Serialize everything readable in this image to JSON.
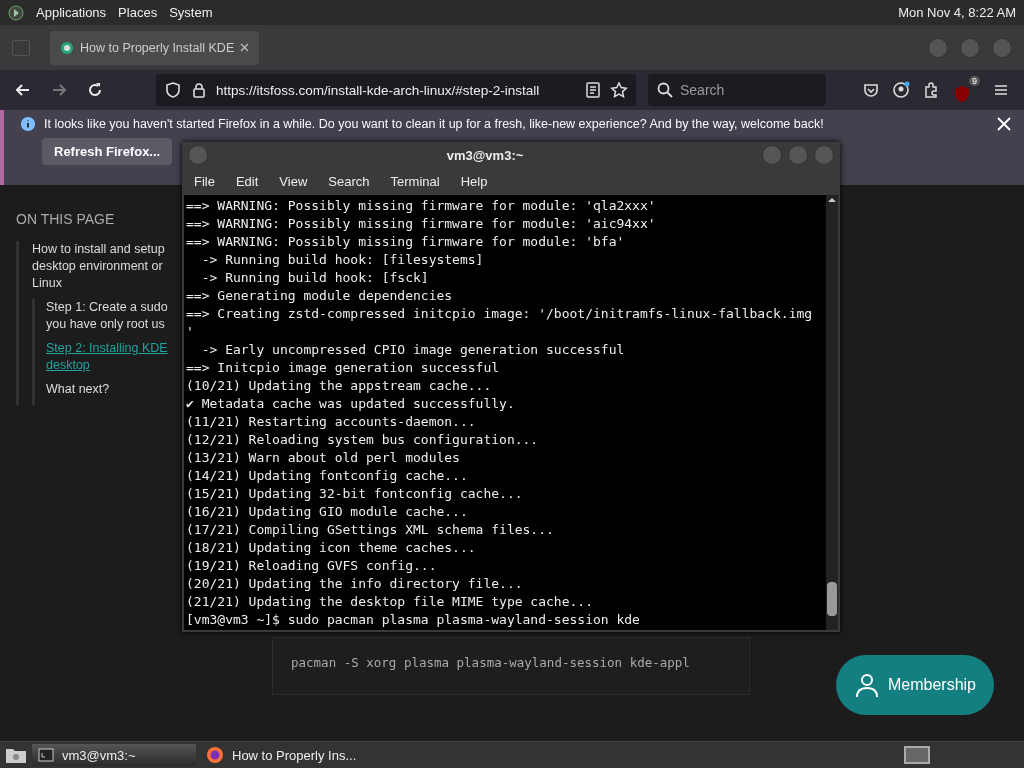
{
  "top_panel": {
    "menus": [
      "Applications",
      "Places",
      "System"
    ],
    "clock": "Mon Nov 4, 8:22 AM"
  },
  "browser": {
    "tab": {
      "title": "How to Properly Install KDE",
      "selected": true
    },
    "nav": [
      {
        "kind": "back",
        "disabled": false
      },
      {
        "kind": "forward",
        "disabled": true
      },
      {
        "kind": "reload",
        "disabled": false
      }
    ],
    "url": "https://itsfoss.com/install-kde-arch-linux/#step-2-install",
    "search": {
      "placeholder": "Search"
    },
    "extension_badge": "9",
    "notification": {
      "message": "It looks like you haven't started Firefox in a while. Do you want to clean it up for a fresh, like-new experience? And by the way, welcome back!",
      "button": "Refresh Firefox..."
    }
  },
  "page": {
    "toc_heading": "ON THIS PAGE",
    "toc": [
      {
        "lines": [
          "How to install and setup",
          "desktop environment or",
          "Linux"
        ],
        "selected": false,
        "children": [
          {
            "lines": [
              "Step 1: Create a sudo",
              "you have only root us"
            ],
            "selected": false
          },
          {
            "lines": [
              "Step 2: Installing KDE",
              "desktop"
            ],
            "selected": true
          },
          {
            "lines": [
              "What next?"
            ],
            "selected": false
          }
        ]
      }
    ],
    "code": "pacman -S xorg plasma plasma-wayland-session kde-appl",
    "membership_button": "Membership"
  },
  "terminal": {
    "title": "vm3@vm3:~",
    "menus": [
      "File",
      "Edit",
      "View",
      "Search",
      "Terminal",
      "Help"
    ],
    "lines": [
      "==> WARNING: Possibly missing firmware for module: 'qla2xxx'",
      "==> WARNING: Possibly missing firmware for module: 'aic94xx'",
      "==> WARNING: Possibly missing firmware for module: 'bfa'",
      "  -> Running build hook: [filesystems]",
      "  -> Running build hook: [fsck]",
      "==> Generating module dependencies",
      "==> Creating zstd-compressed initcpio image: '/boot/initramfs-linux-fallback.img",
      "'",
      "  -> Early uncompressed CPIO image generation successful",
      "==> Initcpio image generation successful",
      "(10/21) Updating the appstream cache...",
      "✔ Metadata cache was updated successfully.",
      "(11/21) Restarting accounts-daemon...",
      "(12/21) Reloading system bus configuration...",
      "(13/21) Warn about old perl modules",
      "(14/21) Updating fontconfig cache...",
      "(15/21) Updating 32-bit fontconfig cache...",
      "(16/21) Updating GIO module cache...",
      "(17/21) Compiling GSettings XML schema files...",
      "(18/21) Updating icon theme caches...",
      "(19/21) Reloading GVFS config...",
      "(20/21) Updating the info directory file...",
      "(21/21) Updating the desktop file MIME type cache...",
      "[vm3@vm3 ~]$ sudo pacman plasma plasma-wayland-session kde"
    ]
  },
  "taskbar": {
    "tasks": [
      {
        "kind": "terminal",
        "label": "vm3@vm3:~",
        "selected": true
      },
      {
        "kind": "browser",
        "label": "How to Properly Ins...",
        "selected": false
      }
    ]
  }
}
